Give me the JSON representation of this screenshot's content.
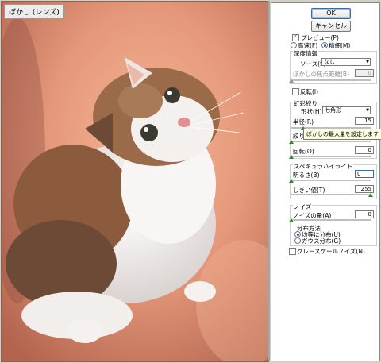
{
  "preview": {
    "title": "ぼかし (レンズ)"
  },
  "buttons": {
    "ok": "OK",
    "cancel": "キャンセル"
  },
  "preview_opts": {
    "label": "プレビュー(P)",
    "fast": "高速(F)",
    "accurate": "精細(M)"
  },
  "depth_map": {
    "heading": "深度情報",
    "source_label": "ソース(S) :",
    "source_value": "なし",
    "focal_label": "ぼかしの焦点距離(B)",
    "focal_value": "0",
    "invert_label": "反転(I)"
  },
  "iris": {
    "heading": "虹彩絞り",
    "shape_label": "形状(H) :",
    "shape_value": "七角形",
    "radius_label": "半径(R)",
    "radius_value": "15",
    "curvature_label": "絞り(V)",
    "rotation_label": "回転(O)",
    "rotation_value": "0",
    "tooltip": "ぼかしの最大量を設定します"
  },
  "specular": {
    "heading": "スペキュラハイライト",
    "brightness_label": "明るさ(B)",
    "brightness_value": "0",
    "threshold_label": "しきい値(T)",
    "threshold_value": "255"
  },
  "noise": {
    "heading": "ノイズ",
    "amount_label": "ノイズの量(A)",
    "amount_value": "0",
    "distribution_label": "分布方法",
    "uniform": "均等に分布(U)",
    "gaussian": "ガウス分布(G)",
    "mono_label": "グレースケールノイズ(N)"
  }
}
